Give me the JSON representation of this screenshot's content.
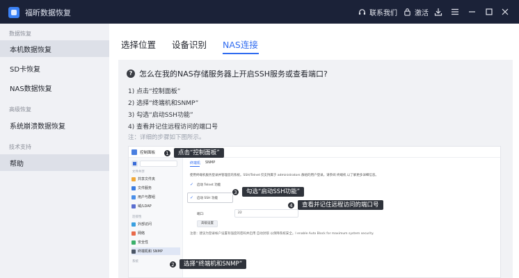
{
  "window": {
    "app_title": "福昕数据恢复",
    "contact_label": "联系我们",
    "activate_label": "激活"
  },
  "icons": {
    "app": "app-logo-icon",
    "contact": "headset-icon",
    "activate": "lock-icon",
    "save": "download-icon",
    "menu": "hamburger-menu-icon",
    "minimize": "minimize-icon",
    "maximize": "maximize-icon",
    "close": "close-icon"
  },
  "sidebar": {
    "group_data_recovery": "数据恢复",
    "item_local": "本机数据恢复",
    "item_sd": "SD卡恢复",
    "item_nas": "NAS数据恢复",
    "group_advanced": "高级恢复",
    "item_crash": "系统崩溃数据恢复",
    "group_support": "技术支持",
    "item_help": "帮助"
  },
  "tabs": {
    "location": "选择位置",
    "device": "设备识别",
    "nas": "NAS连接",
    "active": "nas"
  },
  "faq": {
    "title": "怎么在我的NAS存储服务器上开启SSH服务或查看端口?",
    "step1": "1) 点击“控制面板”",
    "step2": "2) 选择“终端机和SNMP”",
    "step3": "3) 勾选“启动SSH功能”",
    "step4": "4) 查看并记住远程访问的端口号",
    "note": "注：详细的步骤如下图所示。"
  },
  "screenshot": {
    "panel_title": "控制面板",
    "left_groups": [
      "文件共享",
      "连接性",
      "系统"
    ],
    "left_items": [
      "共享文件夹",
      "文件服务",
      "用户与群组",
      "域/LDAP",
      "外部访问",
      "网络",
      "安全性",
      "终端机和 SNMP"
    ],
    "tab1": "终端机",
    "tab2": "SNMP",
    "desc": "使用终端机服务登录并管理您的系统。SSH/Telnet 仅支持属于 administrators 群组的用户登录。请参阅 终端机 以了解更多详细信息。",
    "chk_telnet": "启动 Telnet 功能",
    "chk_ssh": "启动 SSH 功能",
    "port_label": "端口:",
    "port_value": "22",
    "adv_button": "高级设置",
    "note": "注意：建议为登录帐户设置有强度的密码并启用 自动封锁 以保障系统安全。I enable Auto Block for maximum system security."
  },
  "callouts": {
    "c1_num": "1",
    "c1_label": "点击“控制面板”",
    "c2_num": "2",
    "c2_label": "选择“终端机和SNMP”",
    "c3_num": "3",
    "c3_label": "勾选“启动SSH功能”",
    "c4_num": "4",
    "c4_label": "查看并记住远程访问的端口号"
  },
  "colors": {
    "titlebar": "#1b2238",
    "accent": "#2f6bf0",
    "sidebar_bg": "#f0f1f5",
    "sidebar_active": "#dde0e8",
    "card_bg": "#f1f2f5",
    "callout_bg": "#2f333b"
  }
}
